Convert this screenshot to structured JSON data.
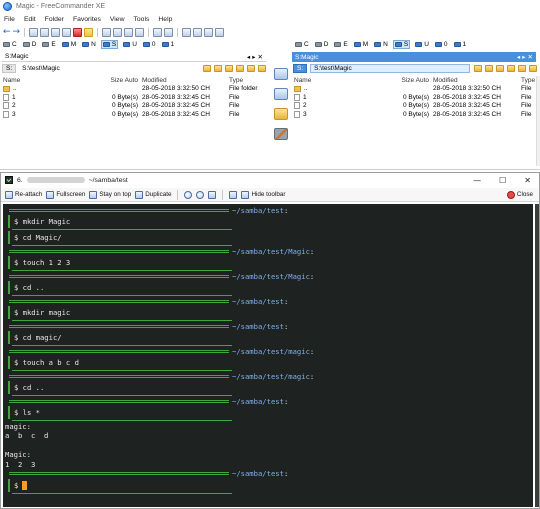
{
  "fc": {
    "title": "Magic - FreeCommander XE",
    "menu": [
      "File",
      "Edit",
      "Folder",
      "Favorites",
      "View",
      "Tools",
      "Help"
    ],
    "drives_left": [
      {
        "label": "C",
        "type": "disk",
        "selected": false
      },
      {
        "label": "D",
        "type": "disk",
        "selected": false
      },
      {
        "label": "E",
        "type": "disk",
        "selected": false
      },
      {
        "label": "M",
        "type": "net",
        "selected": false
      },
      {
        "label": "N",
        "type": "net",
        "selected": false
      },
      {
        "label": "S",
        "type": "net",
        "selected": true
      },
      {
        "label": "U",
        "type": "net",
        "selected": false
      },
      {
        "label": "0",
        "type": "net",
        "selected": false
      },
      {
        "label": "1",
        "type": "net",
        "selected": false
      }
    ],
    "drives_right": [
      {
        "label": "C",
        "type": "disk",
        "selected": false
      },
      {
        "label": "D",
        "type": "disk",
        "selected": false
      },
      {
        "label": "E",
        "type": "disk",
        "selected": false
      },
      {
        "label": "M",
        "type": "net",
        "selected": false
      },
      {
        "label": "N",
        "type": "net",
        "selected": false
      },
      {
        "label": "S",
        "type": "net",
        "selected": true
      },
      {
        "label": "U",
        "type": "net",
        "selected": false
      },
      {
        "label": "0",
        "type": "net",
        "selected": false
      },
      {
        "label": "1",
        "type": "net",
        "selected": false
      }
    ],
    "left": {
      "tab": "S:Magic",
      "drive_tag": "S:",
      "path": "S:\\test\\Magic",
      "columns": {
        "name": "Name",
        "size": "Size Auto",
        "modified": "Modified",
        "type": "Type"
      },
      "rows": [
        {
          "name": "..",
          "size": "",
          "modified": "28-05-2018 3:32:50 CH",
          "type": "File folder",
          "kind": "dir"
        },
        {
          "name": "1",
          "size": "0 Byte(s)",
          "modified": "28-05-2018 3:32:45 CH",
          "type": "File",
          "kind": "file"
        },
        {
          "name": "2",
          "size": "0 Byte(s)",
          "modified": "28-05-2018 3:32:45 CH",
          "type": "File",
          "kind": "file"
        },
        {
          "name": "3",
          "size": "0 Byte(s)",
          "modified": "28-05-2018 3:32:45 CH",
          "type": "File",
          "kind": "file"
        }
      ]
    },
    "right": {
      "tab": "S:Magic",
      "drive_tag": "S:",
      "path": "S:\\test\\Magic",
      "columns": {
        "name": "Name",
        "size": "Size Auto",
        "modified": "Modified",
        "type": "Type"
      },
      "rows": [
        {
          "name": "..",
          "size": "",
          "modified": "28-05-2018 3:32:50 CH",
          "type": "File",
          "kind": "dir"
        },
        {
          "name": "1",
          "size": "0 Byte(s)",
          "modified": "28-05-2018 3:32:45 CH",
          "type": "File",
          "kind": "file"
        },
        {
          "name": "2",
          "size": "0 Byte(s)",
          "modified": "28-05-2018 3:32:45 CH",
          "type": "File",
          "kind": "file"
        },
        {
          "name": "3",
          "size": "0 Byte(s)",
          "modified": "28-05-2018 3:32:45 CH",
          "type": "File",
          "kind": "file"
        }
      ]
    }
  },
  "terminal": {
    "title_prefix": "6.",
    "title_path": "~/samba/test",
    "controls": {
      "minimize": "—",
      "maximize": "☐",
      "close": "✕"
    },
    "toolbar": {
      "reattach": "Re-attach",
      "fullscreen": "Fullscreen",
      "stay_on_top": "Stay on top",
      "duplicate": "Duplicate",
      "hide_toolbar": "Hide toolbar",
      "close": "Close"
    },
    "lines": [
      {
        "kind": "prompt",
        "path": "~/samba/test"
      },
      {
        "kind": "cmd",
        "text": "$ mkdir Magic"
      },
      {
        "kind": "cmd",
        "text": "$ cd Magic/"
      },
      {
        "kind": "prompt",
        "path": "~/samba/test/Magic"
      },
      {
        "kind": "cmd",
        "text": "$ touch 1 2 3"
      },
      {
        "kind": "prompt",
        "path": "~/samba/test/Magic"
      },
      {
        "kind": "cmd",
        "text": "$ cd .."
      },
      {
        "kind": "prompt",
        "path": "~/samba/test"
      },
      {
        "kind": "cmd",
        "text": "$ mkdir magic"
      },
      {
        "kind": "prompt",
        "path": "~/samba/test"
      },
      {
        "kind": "cmd",
        "text": "$ cd magic/"
      },
      {
        "kind": "prompt",
        "path": "~/samba/test/magic"
      },
      {
        "kind": "cmd",
        "text": "$ touch a b c d"
      },
      {
        "kind": "prompt",
        "path": "~/samba/test/magic"
      },
      {
        "kind": "cmd",
        "text": "$ cd .."
      },
      {
        "kind": "prompt",
        "path": "~/samba/test"
      },
      {
        "kind": "cmd",
        "text": "$ ls *"
      },
      {
        "kind": "out",
        "text": "magic:"
      },
      {
        "kind": "out",
        "text": "a  b  c  d"
      },
      {
        "kind": "blank",
        "text": ""
      },
      {
        "kind": "out",
        "text": "Magic:"
      },
      {
        "kind": "out",
        "text": "1  2  3"
      },
      {
        "kind": "prompt",
        "path": "~/samba/test"
      },
      {
        "kind": "input",
        "text": "$"
      }
    ]
  },
  "colors": {
    "console_bg": "#1e2220",
    "prompt_rule": "#3ea63a",
    "prompt_path": "#7fb0ea",
    "cursor": "#f0a21a",
    "active_panel": "#4a8fde"
  }
}
